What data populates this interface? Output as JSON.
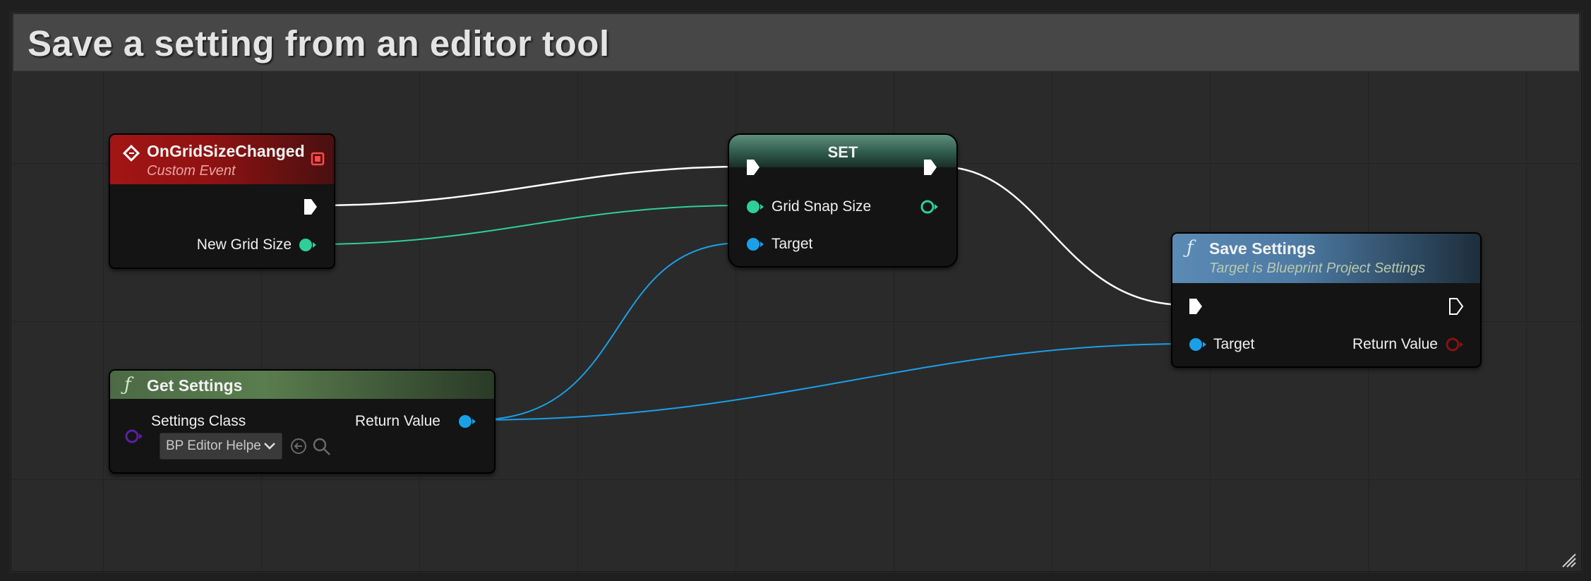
{
  "comment": {
    "title": "Save a setting from an editor tool"
  },
  "nodes": {
    "event": {
      "title": "OnGridSizeChanged",
      "subtitle": "Custom Event",
      "pins": {
        "output_param": "New Grid Size"
      }
    },
    "set": {
      "title": "SET",
      "pins": {
        "input_value": "Grid Snap Size",
        "input_target": "Target"
      }
    },
    "get_settings": {
      "title": "Get Settings",
      "pins": {
        "settings_class": "Settings Class",
        "return_value": "Return Value"
      },
      "class_dropdown": "BP Editor Helpe"
    },
    "save_settings": {
      "title": "Save Settings",
      "subtitle": "Target is Blueprint Project Settings",
      "pins": {
        "target": "Target",
        "return_value": "Return Value"
      }
    }
  },
  "colors": {
    "exec": "#ffffff",
    "float_pin": "#2fcf98",
    "object_pin": "#1aa0e8",
    "class_pin": "#5a1fa8",
    "bool_pin": "#8a1010",
    "event_header": "#8f1212",
    "set_header": "#2e5a4c",
    "get_header": "#5a7d4e",
    "save_header": "#4d7aa3"
  },
  "icons": {
    "event": "custom-event-diamond-icon",
    "delegate": "delegate-square-icon",
    "function": "function-f-icon",
    "browse": "browse-arrow-icon",
    "search": "magnifier-icon",
    "dropdown": "chevron-down-icon"
  }
}
